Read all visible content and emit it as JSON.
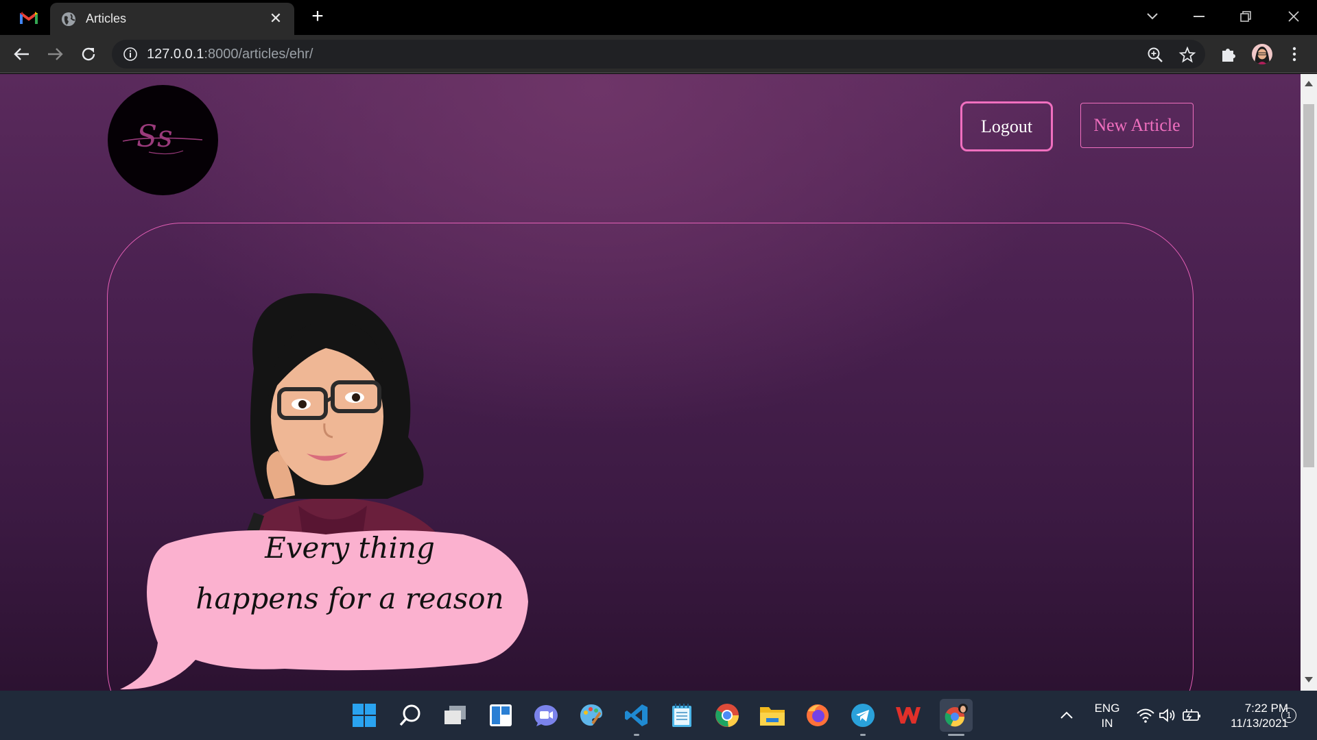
{
  "browser": {
    "tab_title": "Articles",
    "url_host": "127.0.0.1",
    "url_rest": ":8000/articles/ehr/"
  },
  "page": {
    "logo_text": "Ss",
    "logout_label": "Logout",
    "new_article_label": "New Article",
    "bubble_line1": "Every thing",
    "bubble_line2": "happens for a reason"
  },
  "colors": {
    "accent_pink": "#f06fbf",
    "bubble_pink": "#fbb1cf",
    "background_purple": "#4a2150"
  },
  "taskbar": {
    "lang_line1": "ENG",
    "lang_line2": "IN",
    "time": "7:22 PM",
    "date": "11/13/2021",
    "notification_count": "1",
    "apps": [
      "windows-start-icon",
      "search-icon",
      "task-view-icon",
      "widgets-icon",
      "teams-chat-icon",
      "paint-icon",
      "vscode-icon",
      "notepad-icon",
      "chrome-icon",
      "file-explorer-icon",
      "firefox-icon",
      "telegram-icon",
      "wps-office-icon",
      "chrome-profile-icon"
    ]
  }
}
